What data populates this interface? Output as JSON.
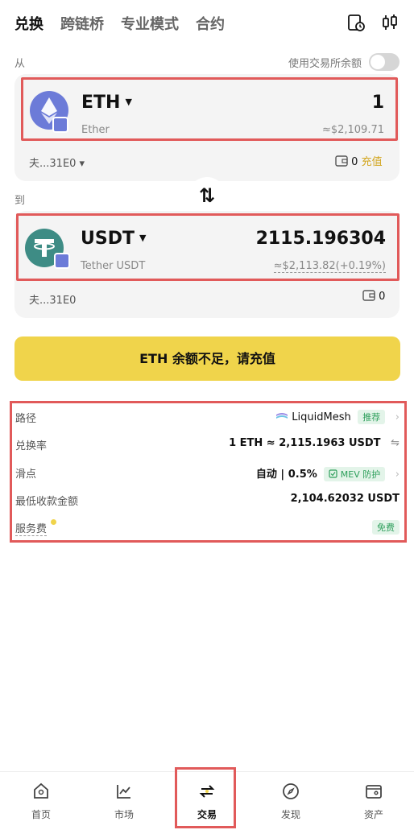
{
  "tabs": [
    "兑换",
    "跨链桥",
    "专业模式",
    "合约"
  ],
  "icons": {
    "history": "history-clock-icon",
    "settings": "sliders-icon"
  },
  "from_label": "从",
  "to_label": "到",
  "use_balance_label": "使用交易所余额",
  "from": {
    "symbol": "ETH",
    "name": "Ether",
    "amount": "1",
    "usd": "≈$2,109.71",
    "address": "夫...31E0 ▾",
    "balance": "0",
    "recharge": "充值"
  },
  "to": {
    "symbol": "USDT",
    "name": "Tether USDT",
    "amount": "2115.196304",
    "usd": "≈$2,113.82(+0.19%)",
    "address": "夫...31E0",
    "balance": "0"
  },
  "swap_arrow": "⇅",
  "cta_label": "ETH 余额不足，请充值",
  "details": {
    "route_label": "路径",
    "route_value": "LiquidMesh",
    "route_badge": "推荐",
    "rate_label": "兑换率",
    "rate_value": "1 ETH ≈ 2,115.1963 USDT",
    "slippage_label": "滑点",
    "slippage_value": "自动 | 0.5%",
    "mev_badge": "MEV 防护",
    "min_label": "最低收款金额",
    "min_value": "2,104.62032 USDT",
    "fee_label": "服务费",
    "fee_badge": "免费"
  },
  "bottom_nav": {
    "home": "首页",
    "market": "市场",
    "trade": "交易",
    "discover": "发现",
    "assets": "资产"
  },
  "colors": {
    "accent_yellow": "#f0d44b",
    "eth_purple": "#6c7bd8",
    "usdt_teal": "#3e8c85",
    "highlight_red": "#e15a5a",
    "green_badge": "#2e9f5c"
  }
}
